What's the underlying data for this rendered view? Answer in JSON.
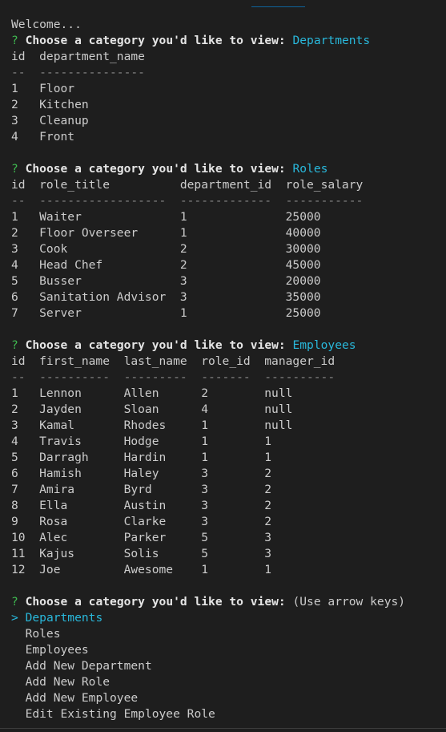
{
  "welcome": "Welcome...",
  "prompt": {
    "marker": "?",
    "question": "Choose a category you'd like to view:"
  },
  "departments": {
    "answer": "Departments",
    "headers": [
      "id",
      "department_name"
    ],
    "separators": [
      "--",
      "---------------"
    ],
    "rows": [
      [
        "1",
        "Floor"
      ],
      [
        "2",
        "Kitchen"
      ],
      [
        "3",
        "Cleanup"
      ],
      [
        "4",
        "Front"
      ]
    ]
  },
  "roles": {
    "answer": "Roles",
    "headers": [
      "id",
      "role_title",
      "department_id",
      "role_salary"
    ],
    "separators": [
      "--",
      "------------------",
      "-------------",
      "-----------"
    ],
    "rows": [
      [
        "1",
        "Waiter",
        "1",
        "25000"
      ],
      [
        "2",
        "Floor Overseer",
        "1",
        "40000"
      ],
      [
        "3",
        "Cook",
        "2",
        "30000"
      ],
      [
        "4",
        "Head Chef",
        "2",
        "45000"
      ],
      [
        "5",
        "Busser",
        "3",
        "20000"
      ],
      [
        "6",
        "Sanitation Advisor",
        "3",
        "35000"
      ],
      [
        "7",
        "Server",
        "1",
        "25000"
      ]
    ]
  },
  "employees": {
    "answer": "Employees",
    "headers": [
      "id",
      "first_name",
      "last_name",
      "role_id",
      "manager_id"
    ],
    "separators": [
      "--",
      "----------",
      "---------",
      "-------",
      "----------"
    ],
    "rows": [
      [
        "1",
        "Lennon",
        "Allen",
        "2",
        "null"
      ],
      [
        "2",
        "Jayden",
        "Sloan",
        "4",
        "null"
      ],
      [
        "3",
        "Kamal",
        "Rhodes",
        "1",
        "null"
      ],
      [
        "4",
        "Travis",
        "Hodge",
        "1",
        "1"
      ],
      [
        "5",
        "Darragh",
        "Hardin",
        "1",
        "1"
      ],
      [
        "6",
        "Hamish",
        "Haley",
        "3",
        "2"
      ],
      [
        "7",
        "Amira",
        "Byrd",
        "3",
        "2"
      ],
      [
        "8",
        "Ella",
        "Austin",
        "3",
        "2"
      ],
      [
        "9",
        "Rosa",
        "Clarke",
        "3",
        "2"
      ],
      [
        "10",
        "Alec",
        "Parker",
        "5",
        "3"
      ],
      [
        "11",
        "Kajus",
        "Solis",
        "5",
        "3"
      ],
      [
        "12",
        "Joe",
        "Awesome",
        "1",
        "1"
      ]
    ]
  },
  "final_prompt": {
    "hint": "(Use arrow keys)",
    "pointer": ">",
    "options": [
      "Departments",
      "Roles",
      "Employees",
      "Add New Department",
      "Add New Role",
      "Add New Employee",
      "Edit Existing Employee Role"
    ]
  }
}
